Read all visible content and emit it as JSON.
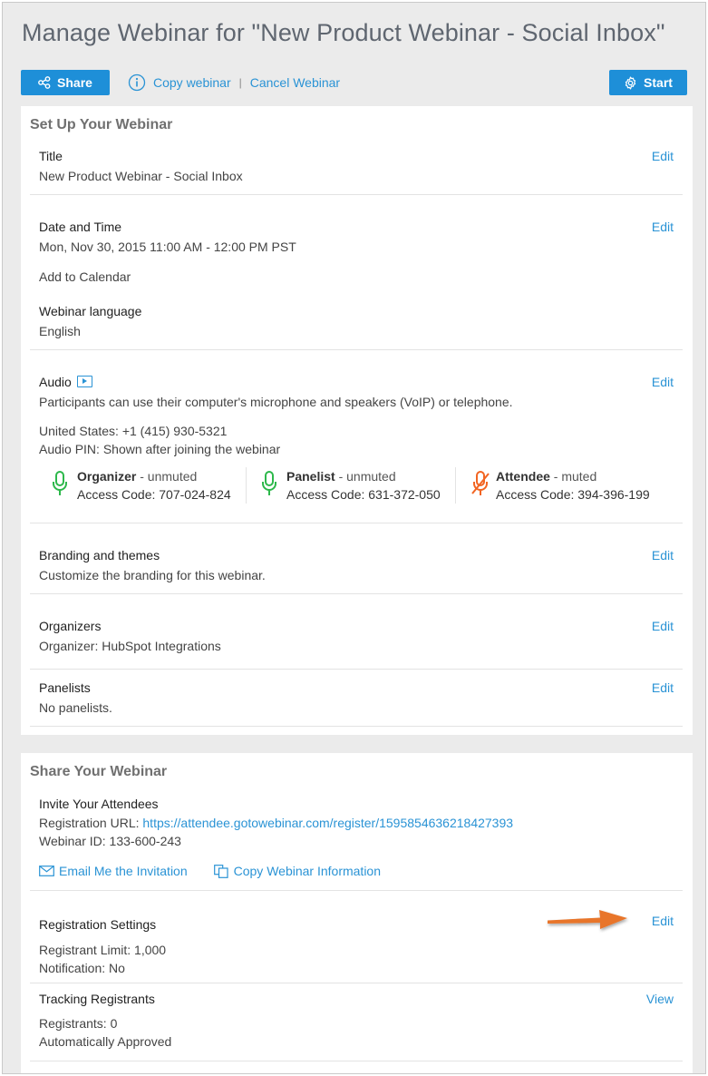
{
  "page": {
    "title": "Manage Webinar for \"New Product Webinar - Social Inbox\""
  },
  "toolbar": {
    "share_label": "Share",
    "copy_label": "Copy webinar",
    "separator": "|",
    "cancel_label": "Cancel Webinar",
    "start_label": "Start"
  },
  "setup": {
    "heading": "Set Up Your Webinar",
    "edit_label": "Edit",
    "title_section": {
      "label": "Title",
      "value": "New Product Webinar - Social Inbox"
    },
    "datetime_section": {
      "label": "Date and Time",
      "value": "Mon, Nov 30, 2015 11:00 AM - 12:00 PM PST",
      "add_calendar": "Add to Calendar",
      "language_label": "Webinar language",
      "language_value": "English"
    },
    "audio_section": {
      "label": "Audio",
      "description": "Participants can use their computer's microphone and speakers (VoIP) or telephone.",
      "phone": "United States: +1 (415) 930-5321",
      "pin": "Audio PIN: Shown after joining the webinar",
      "roles": [
        {
          "role": "Organizer",
          "status": " - unmuted",
          "code": "Access Code: 707-024-824",
          "icon": "microphone-icon",
          "color": "#2db84b"
        },
        {
          "role": "Panelist",
          "status": " - unmuted",
          "code": "Access Code: 631-372-050",
          "icon": "microphone-icon",
          "color": "#2db84b"
        },
        {
          "role": "Attendee",
          "status": " - muted",
          "code": "Access Code: 394-396-199",
          "icon": "microphone-muted-icon",
          "color": "#f26522"
        }
      ]
    },
    "branding_section": {
      "label": "Branding and themes",
      "value": "Customize the branding for this webinar."
    },
    "organizers_section": {
      "label": "Organizers",
      "value": "Organizer: HubSpot Integrations"
    },
    "panelists_section": {
      "label": "Panelists",
      "value": "No panelists."
    }
  },
  "share": {
    "heading": "Share Your Webinar",
    "invite_label": "Invite Your Attendees",
    "registration_url_label": "Registration URL: ",
    "registration_url": "https://attendee.gotowebinar.com/register/1595854636218427393",
    "webinar_id": "Webinar ID: 133-600-243",
    "email_invite": "Email Me the Invitation",
    "copy_info": "Copy Webinar Information",
    "registration_settings": {
      "label": "Registration Settings",
      "edit_label": "Edit",
      "limit": "Registrant Limit: 1,000",
      "notification": "Notification: No"
    },
    "tracking": {
      "label": "Tracking Registrants",
      "view_label": "View",
      "registrants": "Registrants: 0",
      "approval": "Automatically Approved"
    }
  },
  "colors": {
    "accent": "#2a93d5",
    "button": "#1e8fd8",
    "annotation_arrow": "#e8742a"
  }
}
